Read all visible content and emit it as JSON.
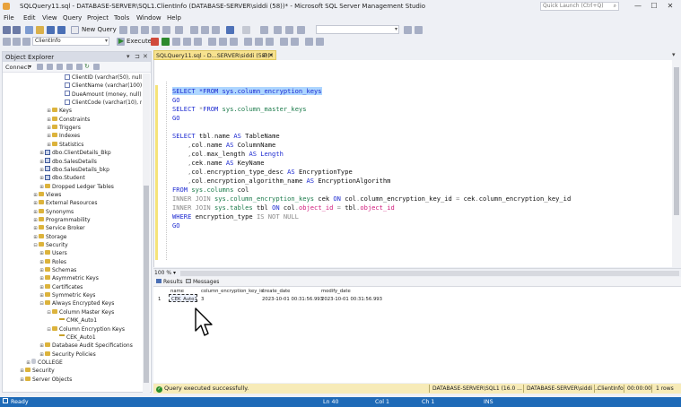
{
  "window": {
    "title": "SQLQuery11.sql - DATABASE-SERVER\\SQL1.ClientInfo (DATABASE-SERVER\\siddi (58))* - Microsoft SQL Server Management Studio",
    "quick_launch_placeholder": "Quick Launch (Ctrl+Q)",
    "controls": {
      "minimize": "—",
      "maximize": "☐",
      "close": "✕"
    }
  },
  "menu": [
    "File",
    "Edit",
    "View",
    "Query",
    "Project",
    "Tools",
    "Window",
    "Help"
  ],
  "toolbar": {
    "new_query": "New Query",
    "database": "ClientInfo",
    "execute": "Execute"
  },
  "object_explorer": {
    "title": "Object Explorer",
    "connect": "Connect",
    "controls": {
      "pin": "⊐",
      "close": "✕",
      "dropdown": "▾"
    },
    "tree": [
      {
        "label": "ClientID (varchar(50), null)",
        "icon": "col",
        "exp": ""
      },
      {
        "label": "ClientName (varchar(100), null)",
        "icon": "col",
        "exp": ""
      },
      {
        "label": "DueAmount (money, null)",
        "icon": "col",
        "exp": ""
      },
      {
        "label": "ClientCode (varchar(10), null)",
        "icon": "col",
        "exp": ""
      },
      {
        "label": "Keys",
        "icon": "folder",
        "exp": "⊞"
      },
      {
        "label": "Constraints",
        "icon": "folder",
        "exp": "⊞"
      },
      {
        "label": "Triggers",
        "icon": "folder",
        "exp": "⊞"
      },
      {
        "label": "Indexes",
        "icon": "folder",
        "exp": "⊞"
      },
      {
        "label": "Statistics",
        "icon": "folder",
        "exp": "⊞"
      },
      {
        "label": "dbo.ClientDetails_Bkp",
        "icon": "table",
        "exp": "⊞"
      },
      {
        "label": "dbo.SalesDetails",
        "icon": "table",
        "exp": "⊞"
      },
      {
        "label": "dbo.SalesDetails_bkp",
        "icon": "table",
        "exp": "⊞"
      },
      {
        "label": "dbo.Student",
        "icon": "table",
        "exp": "⊞"
      },
      {
        "label": "Dropped Ledger Tables",
        "icon": "folder",
        "exp": "⊞"
      },
      {
        "label": "Views",
        "icon": "folder",
        "exp": "⊞"
      },
      {
        "label": "External Resources",
        "icon": "folder",
        "exp": "⊞"
      },
      {
        "label": "Synonyms",
        "icon": "folder",
        "exp": "⊞"
      },
      {
        "label": "Programmability",
        "icon": "folder",
        "exp": "⊞"
      },
      {
        "label": "Service Broker",
        "icon": "folder",
        "exp": "⊞"
      },
      {
        "label": "Storage",
        "icon": "folder",
        "exp": "⊞"
      },
      {
        "label": "Security",
        "icon": "folder",
        "exp": "⊟"
      },
      {
        "label": "Users",
        "icon": "folder",
        "exp": "⊞"
      },
      {
        "label": "Roles",
        "icon": "folder",
        "exp": "⊞"
      },
      {
        "label": "Schemas",
        "icon": "folder",
        "exp": "⊞"
      },
      {
        "label": "Asymmetric Keys",
        "icon": "folder",
        "exp": "⊞"
      },
      {
        "label": "Certificates",
        "icon": "folder",
        "exp": "⊞"
      },
      {
        "label": "Symmetric Keys",
        "icon": "folder",
        "exp": "⊞"
      },
      {
        "label": "Always Encrypted Keys",
        "icon": "folder",
        "exp": "⊟"
      },
      {
        "label": "Column Master Keys",
        "icon": "folder",
        "exp": "⊟"
      },
      {
        "label": "CMK_Auto1",
        "icon": "key",
        "exp": ""
      },
      {
        "label": "Column Encryption Keys",
        "icon": "folder",
        "exp": "⊟"
      },
      {
        "label": "CEK_Auto1",
        "icon": "key",
        "exp": ""
      },
      {
        "label": "Database Audit Specifications",
        "icon": "folder",
        "exp": "⊞"
      },
      {
        "label": "Security Policies",
        "icon": "folder",
        "exp": "⊞"
      },
      {
        "label": "COLLEGE",
        "icon": "db",
        "exp": "⊞"
      },
      {
        "label": "Security",
        "icon": "folder",
        "exp": "⊞"
      },
      {
        "label": "Server Objects",
        "icon": "folder",
        "exp": "⊞"
      }
    ]
  },
  "document_tab": {
    "label": "SQLQuery11.sql - D...SERVER\\siddi (58))*",
    "pin": "⊐",
    "close": "✕",
    "dropdown": "▾"
  },
  "editor": {
    "lines": [
      [
        [
          "SELECT *FROM sys.column_encryption_keys",
          "kw sel"
        ]
      ],
      [
        [
          "GO",
          "kw"
        ]
      ],
      [
        [
          "SELECT ",
          "kw"
        ],
        [
          "*",
          "gr"
        ],
        [
          "FROM ",
          "kw"
        ],
        [
          "sys.column_master_keys",
          "gn"
        ]
      ],
      [
        [
          "GO",
          "kw"
        ]
      ],
      [
        [
          "",
          ""
        ]
      ],
      [
        [
          "SELECT ",
          "kw"
        ],
        [
          "tbl",
          ""
        ],
        [
          ".",
          "gr"
        ],
        [
          "name ",
          ""
        ],
        [
          "AS ",
          "kw"
        ],
        [
          "TableName",
          ""
        ]
      ],
      [
        [
          "    ,",
          "gr"
        ],
        [
          "col",
          ""
        ],
        [
          ".",
          "gr"
        ],
        [
          "name ",
          ""
        ],
        [
          "AS ",
          "kw"
        ],
        [
          "ColumnName",
          ""
        ]
      ],
      [
        [
          "    ,",
          "gr"
        ],
        [
          "col",
          ""
        ],
        [
          ".",
          "gr"
        ],
        [
          "max_length ",
          ""
        ],
        [
          "AS ",
          "kw"
        ],
        [
          "Length",
          "kw"
        ]
      ],
      [
        [
          "    ,",
          "gr"
        ],
        [
          "cek",
          ""
        ],
        [
          ".",
          "gr"
        ],
        [
          "name ",
          ""
        ],
        [
          "AS ",
          "kw"
        ],
        [
          "KeyName",
          ""
        ]
      ],
      [
        [
          "    ,",
          "gr"
        ],
        [
          "col",
          ""
        ],
        [
          ".",
          "gr"
        ],
        [
          "encryption_type_desc ",
          ""
        ],
        [
          "AS ",
          "kw"
        ],
        [
          "EncryptionType",
          ""
        ]
      ],
      [
        [
          "    ,",
          "gr"
        ],
        [
          "col",
          ""
        ],
        [
          ".",
          "gr"
        ],
        [
          "encryption_algorithm_name ",
          ""
        ],
        [
          "AS ",
          "kw"
        ],
        [
          "EncryptionAlgorithm",
          ""
        ]
      ],
      [
        [
          "FROM ",
          "kw"
        ],
        [
          "sys.columns ",
          "gn"
        ],
        [
          "col",
          ""
        ]
      ],
      [
        [
          "INNER JOIN ",
          "gr"
        ],
        [
          "sys.column_encryption_keys ",
          "gn"
        ],
        [
          "cek ",
          ""
        ],
        [
          "ON ",
          "kw"
        ],
        [
          "col",
          ""
        ],
        [
          ".",
          "gr"
        ],
        [
          "column_encryption_key_id ",
          ""
        ],
        [
          "= ",
          "gr"
        ],
        [
          "cek",
          ""
        ],
        [
          ".",
          "gr"
        ],
        [
          "column_encryption_key_id",
          ""
        ]
      ],
      [
        [
          "INNER JOIN ",
          "gr"
        ],
        [
          "sys.tables ",
          "gn"
        ],
        [
          "tbl ",
          ""
        ],
        [
          "ON ",
          "kw"
        ],
        [
          "col",
          ""
        ],
        [
          ".",
          "gr"
        ],
        [
          "object_id",
          "fn"
        ],
        [
          " = ",
          "gr"
        ],
        [
          "tbl",
          ""
        ],
        [
          ".",
          "gr"
        ],
        [
          "object_id",
          "fn"
        ]
      ],
      [
        [
          "WHERE ",
          "kw"
        ],
        [
          "encryption_type ",
          ""
        ],
        [
          "IS NOT NULL",
          "gr"
        ]
      ],
      [
        [
          "GO",
          "kw"
        ]
      ]
    ]
  },
  "zoom": "100 %",
  "results": {
    "tabs": [
      "Results",
      "Messages"
    ],
    "columns": [
      "name",
      "column_encryption_key_id",
      "create_date",
      "modify_date"
    ],
    "rows": [
      [
        "1",
        "CEK_Auto1",
        "3",
        "2023-10-01 00:31:56.993",
        "2023-10-01 00:31:56.993"
      ]
    ]
  },
  "query_status": {
    "message": "Query executed successfully.",
    "server": "DATABASE-SERVER\\SQL1 (16.0 ...",
    "user": "DATABASE-SERVER\\siddi ...",
    "database": "ClientInfo",
    "time": "00:00:00",
    "rows": "1 rows"
  },
  "status_bar": {
    "ready": "Ready",
    "ln": "Ln 40",
    "col": "Col 1",
    "ch": "Ch 1",
    "ins": "INS"
  },
  "colors": {
    "accent": "#1e6ab7",
    "tab_active": "#f7e28f",
    "selection": "#add6ff",
    "keyword": "#1f2cd1"
  }
}
